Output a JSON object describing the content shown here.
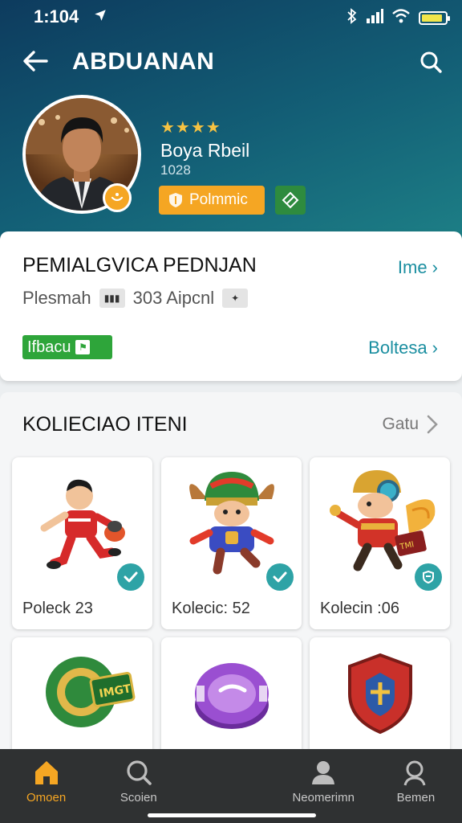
{
  "status_bar": {
    "time": "1:104"
  },
  "header": {
    "title": "ABDUANAN",
    "player": {
      "stars": "★★★★",
      "name": "Boya Rbeil",
      "number": "1028"
    },
    "promo_label": "Polmmic"
  },
  "info": {
    "title": "PEMIALGVICA PEDNJAN",
    "link": "Ime ›",
    "row_label": "Plesmah",
    "row_value": "303 Aipcnl",
    "tag": "Ifbacu",
    "link2": "Boltesa ›"
  },
  "collection": {
    "title": "KOLIECIAO ITENI",
    "link": "Gatu",
    "items": [
      {
        "label": "Poleck 23"
      },
      {
        "label": "Kolecic: 52"
      },
      {
        "label": "Kolecin :06"
      },
      {
        "label": ""
      },
      {
        "label": ""
      },
      {
        "label": ""
      }
    ]
  },
  "nav": [
    {
      "label": "Omoen",
      "icon": "home-icon"
    },
    {
      "label": "Scoien",
      "icon": "search-icon"
    },
    {
      "label": "",
      "icon": ""
    },
    {
      "label": "Neomerimn",
      "icon": "person-icon"
    },
    {
      "label": "Bemen",
      "icon": "person-search-icon"
    }
  ],
  "colors": {
    "header": "#135f76",
    "accent": "#f5a623",
    "teal": "#2ea3a6",
    "green": "#2ea53a"
  }
}
